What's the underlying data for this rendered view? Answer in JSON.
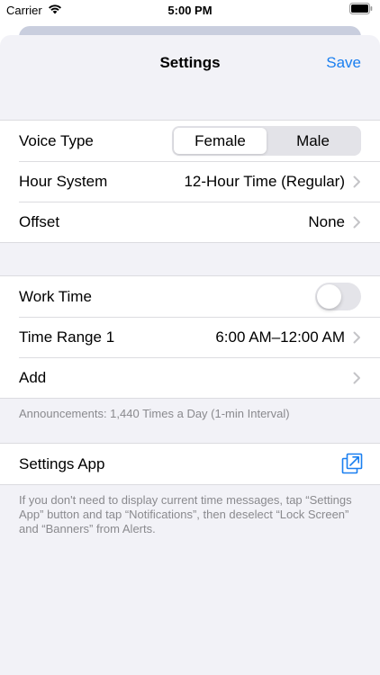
{
  "status_bar": {
    "carrier": "Carrier",
    "time": "5:00 PM"
  },
  "nav": {
    "title": "Settings",
    "save": "Save"
  },
  "voice": {
    "label": "Voice Type",
    "options": [
      "Female",
      "Male"
    ],
    "selected": "Female"
  },
  "hour_system": {
    "label": "Hour System",
    "value": "12-Hour Time (Regular)"
  },
  "offset": {
    "label": "Offset",
    "value": "None"
  },
  "work_time": {
    "label": "Work Time",
    "enabled": false
  },
  "time_range": {
    "label": "Time Range 1",
    "value": "6:00 AM–12:00 AM"
  },
  "add": {
    "label": "Add"
  },
  "announcements_footer": "Announcements: 1,440 Times a Day (1-min Interval)",
  "settings_app": {
    "label": "Settings App"
  },
  "settings_footer": "If you don't need to display current time messages, tap “Settings App” button and tap “Notifications”, then deselect “Lock Screen” and “Banners” from Alerts.",
  "colors": {
    "accent": "#1a7ff0",
    "background": "#f2f2f7",
    "secondary_text": "#8a8a8e"
  },
  "icons": [
    "wifi-icon",
    "battery-icon",
    "chevron-right-icon",
    "open-external-icon"
  ]
}
